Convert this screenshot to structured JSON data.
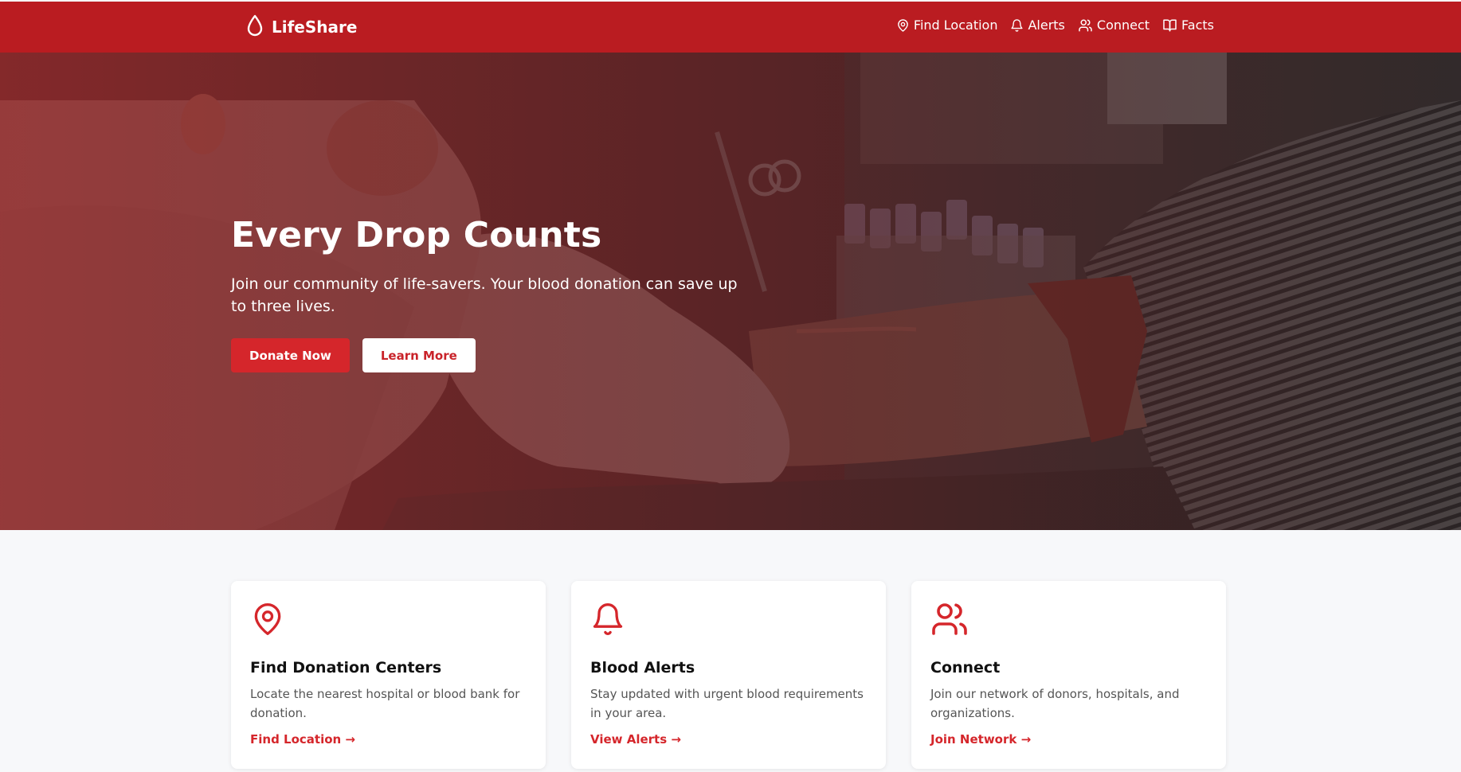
{
  "brand": {
    "name": "LifeShare",
    "color": "#ba1c21",
    "accent": "#d5262b"
  },
  "nav": {
    "items": [
      {
        "label": "Find Location",
        "icon": "map-pin-icon"
      },
      {
        "label": "Alerts",
        "icon": "bell-icon"
      },
      {
        "label": "Connect",
        "icon": "users-icon"
      },
      {
        "label": "Facts",
        "icon": "book-icon"
      }
    ]
  },
  "hero": {
    "title": "Every Drop Counts",
    "subtitle": "Join our community of life-savers. Your blood donation can save up to three lives.",
    "primary_button": "Donate Now",
    "secondary_button": "Learn More"
  },
  "cards": [
    {
      "icon": "map-pin-icon",
      "title": "Find Donation Centers",
      "description": "Locate the nearest hospital or blood bank for donation.",
      "link": "Find Location →"
    },
    {
      "icon": "bell-icon",
      "title": "Blood Alerts",
      "description": "Stay updated with urgent blood requirements in your area.",
      "link": "View Alerts →"
    },
    {
      "icon": "users-icon",
      "title": "Connect",
      "description": "Join our network of donors, hospitals, and organizations.",
      "link": "Join Network →"
    }
  ]
}
